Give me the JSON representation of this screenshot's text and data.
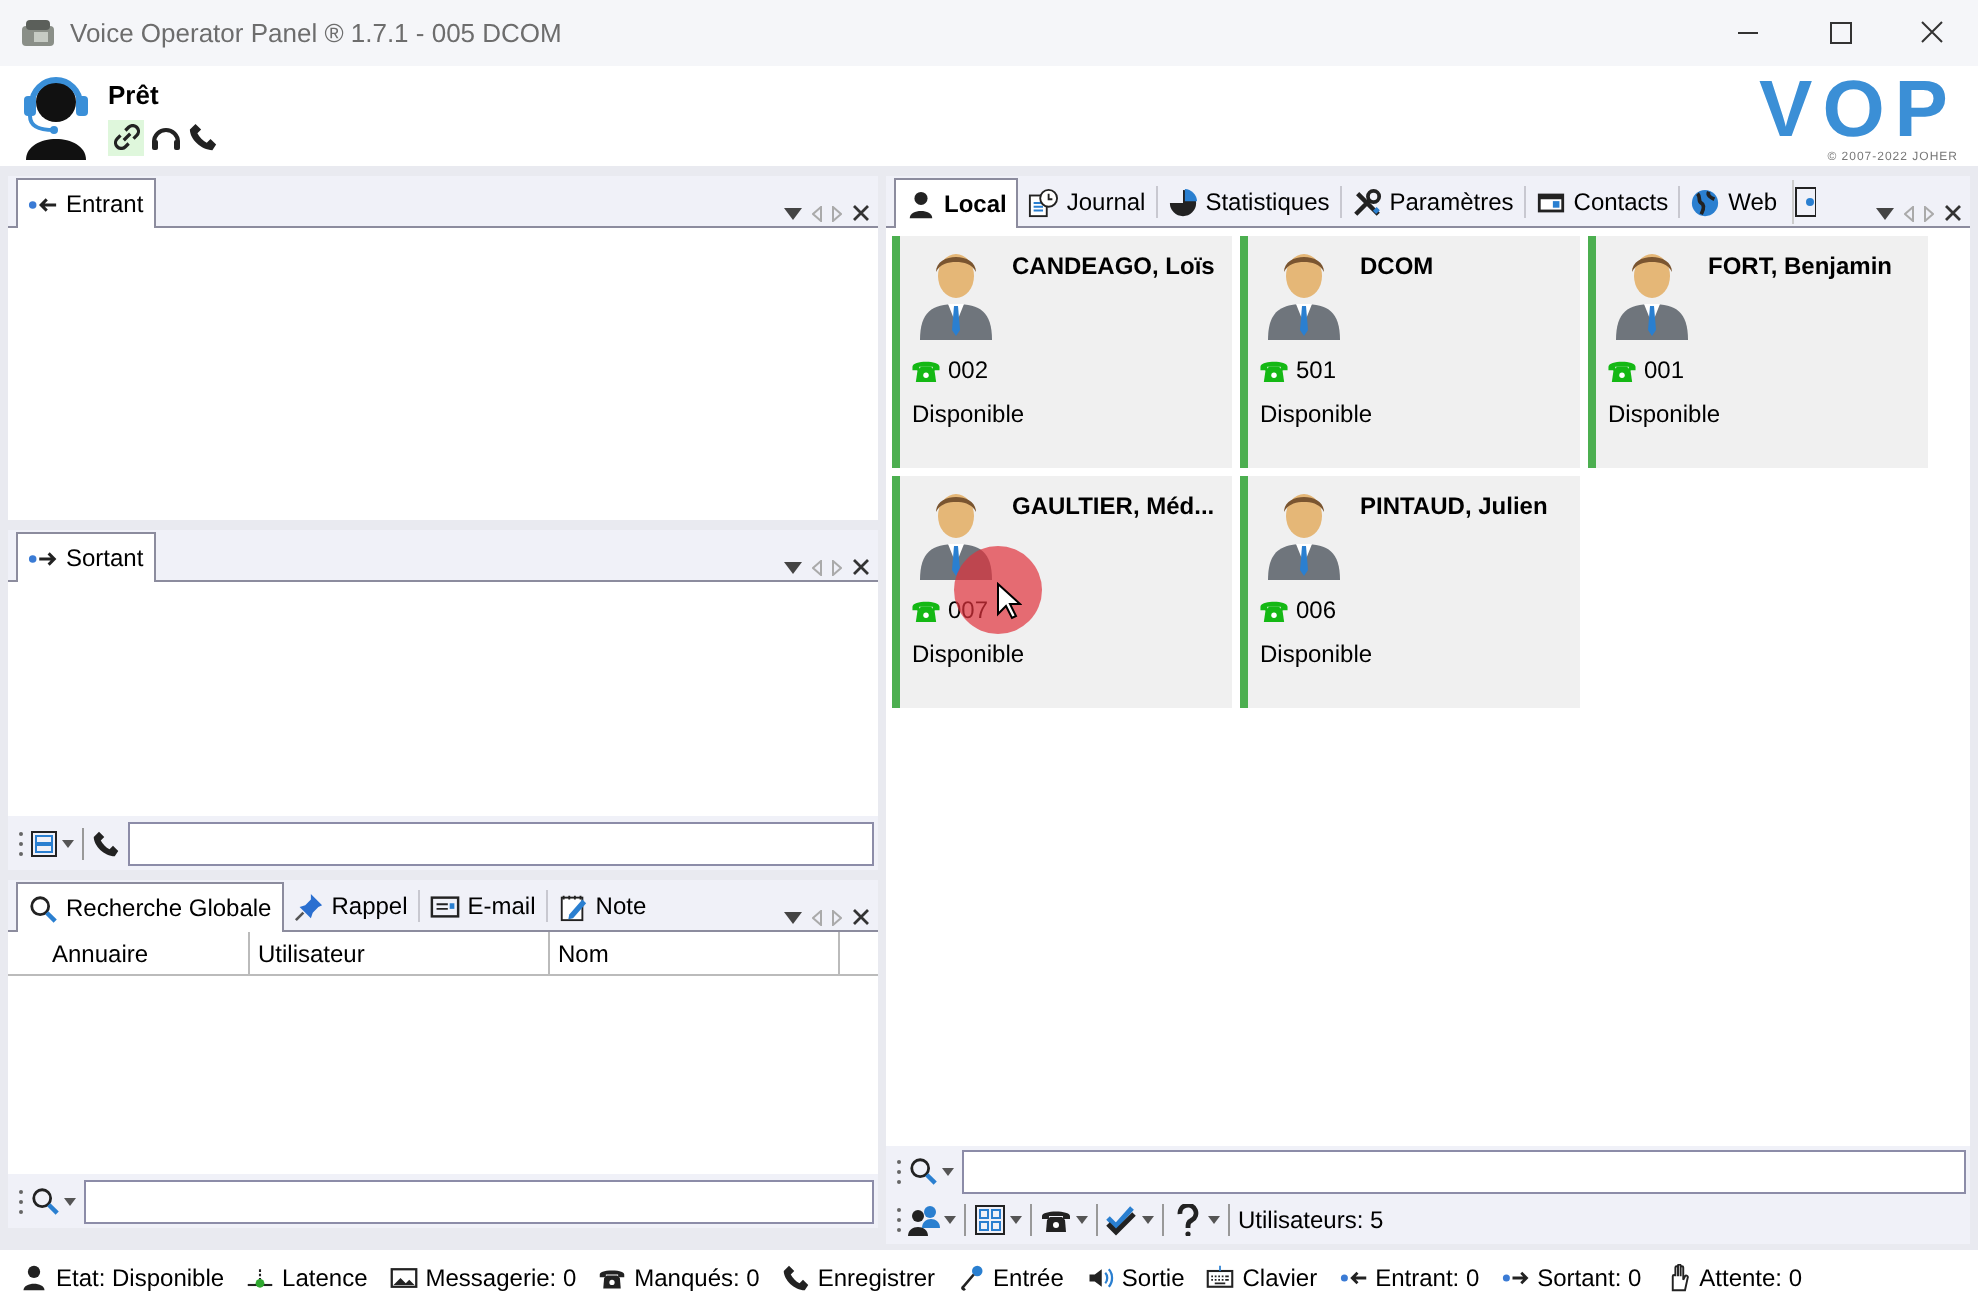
{
  "window": {
    "title": "Voice Operator Panel ® 1.7.1 - 005 DCOM"
  },
  "header": {
    "status": "Prêt",
    "logo": "VOP",
    "copyright": "© 2007-2022 JOHER",
    "link_active": true
  },
  "left_panels": [
    {
      "kind": "plain",
      "tabs": [
        {
          "label": "Entrant",
          "kind": "in",
          "selected": true
        }
      ]
    },
    {
      "kind": "dial",
      "tabs": [
        {
          "label": "Sortant",
          "kind": "out",
          "selected": true
        }
      ]
    },
    {
      "kind": "search",
      "tabs": [
        {
          "label": "Recherche Globale",
          "kind": "search",
          "selected": true
        },
        {
          "label": "Rappel",
          "kind": "pin",
          "selected": false
        },
        {
          "label": "E-mail",
          "kind": "mail",
          "selected": false
        },
        {
          "label": "Note",
          "kind": "note",
          "selected": false
        }
      ],
      "columns": [
        "Annuaire",
        "Utilisateur",
        "Nom"
      ]
    }
  ],
  "right_panel": {
    "tabs": [
      {
        "label": "Local",
        "kind": "user",
        "selected": true
      },
      {
        "label": "Journal",
        "kind": "journal",
        "selected": false
      },
      {
        "label": "Statistiques",
        "kind": "pie",
        "selected": false
      },
      {
        "label": "Paramètres",
        "kind": "tools",
        "selected": false
      },
      {
        "label": "Contacts",
        "kind": "card",
        "selected": false
      },
      {
        "label": "Web",
        "kind": "globe",
        "selected": false
      }
    ],
    "users": [
      {
        "name": "CANDEAGO, Loïs",
        "extension": "002",
        "status": "Disponible",
        "color": "#4caf50"
      },
      {
        "name": "DCOM",
        "extension": "501",
        "status": "Disponible",
        "color": "#4caf50"
      },
      {
        "name": "FORT, Benjamin",
        "extension": "001",
        "status": "Disponible",
        "color": "#4caf50"
      },
      {
        "name": "GAULTIER, Méd...",
        "extension": "007",
        "status": "Disponible",
        "color": "#4caf50"
      },
      {
        "name": "PINTAUD, Julien",
        "extension": "006",
        "status": "Disponible",
        "color": "#4caf50"
      }
    ],
    "user_count": "Utilisateurs: 5"
  },
  "status_bar": [
    {
      "label": "Etat: Disponible",
      "kind": "user"
    },
    {
      "label": "Latence",
      "kind": "latency"
    },
    {
      "label": "Messagerie: 0",
      "kind": "voicemail"
    },
    {
      "label": "Manqués: 0",
      "kind": "phone"
    },
    {
      "label": "Enregistrer",
      "kind": "handset"
    },
    {
      "label": "Entrée",
      "kind": "mic"
    },
    {
      "label": "Sortie",
      "kind": "speaker"
    },
    {
      "label": "Clavier",
      "kind": "keyboard"
    },
    {
      "label": "Entrant: 0",
      "kind": "in"
    },
    {
      "label": "Sortant: 0",
      "kind": "out"
    },
    {
      "label": "Attente: 0",
      "kind": "hold"
    }
  ]
}
